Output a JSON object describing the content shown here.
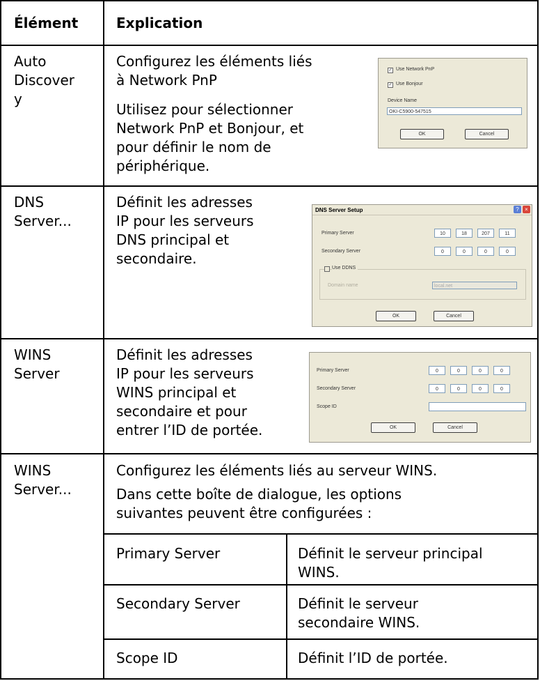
{
  "header": {
    "col1": "Élément",
    "col2": "Explication"
  },
  "rows": [
    {
      "element": "Auto Discover y",
      "lines": [
        "Configurez les éléments liés",
        "à Network PnP"
      ],
      "lines2": [
        "Utilisez pour sélectionner",
        "Network PnP et Bonjour, et",
        "pour définir le nom de",
        "périphérique."
      ],
      "dialog": {
        "use_pnp": "Use Network PnP",
        "use_bonjour": "Use Bonjour",
        "device_name_label": "Device Name",
        "device_name_value": "OKI-C5900-547515",
        "ok": "OK",
        "cancel": "Cancel"
      }
    },
    {
      "element": "DNS Server...",
      "lines": [
        "Définit les adresses",
        "IP pour les serveurs",
        "DNS principal et",
        "secondaire."
      ],
      "dialog": {
        "title": "DNS Server Setup",
        "primary_label": "Primary Server",
        "primary_ip": [
          "10",
          "18",
          "207",
          "11"
        ],
        "secondary_label": "Secondary Server",
        "secondary_ip": [
          "0",
          "0",
          "0",
          "0"
        ],
        "use_ddns": "Use DDNS",
        "domain_name_label": "Domain name",
        "domain_name_value": "local.net",
        "ok": "OK",
        "cancel": "Cancel"
      }
    },
    {
      "element": "WINS Server",
      "lines": [
        "Définit les adresses",
        "IP pour les serveurs",
        "WINS principal et",
        "secondaire et pour",
        "entrer l’ID de portée."
      ],
      "dialog": {
        "primary_label": "Primary Server",
        "primary_ip": [
          "0",
          "0",
          "0",
          "0"
        ],
        "secondary_label": "Secondary Server",
        "secondary_ip": [
          "0",
          "0",
          "0",
          "0"
        ],
        "scope_label": "Scope ID",
        "ok": "OK",
        "cancel": "Cancel"
      }
    },
    {
      "element": "WINS Server...",
      "intro1": "Configurez les éléments liés au serveur WINS.",
      "intro2": [
        "Dans cette boîte de dialogue, les options",
        "suivantes peuvent être configurées :"
      ],
      "options": [
        {
          "name": "Primary Server",
          "desc": [
            "Définit le serveur principal",
            "WINS."
          ]
        },
        {
          "name": "Secondary Server",
          "desc": [
            "Définit le serveur",
            "secondaire WINS."
          ]
        },
        {
          "name": "Scope ID",
          "desc": [
            "Définit l’ID de portée."
          ]
        }
      ]
    }
  ]
}
